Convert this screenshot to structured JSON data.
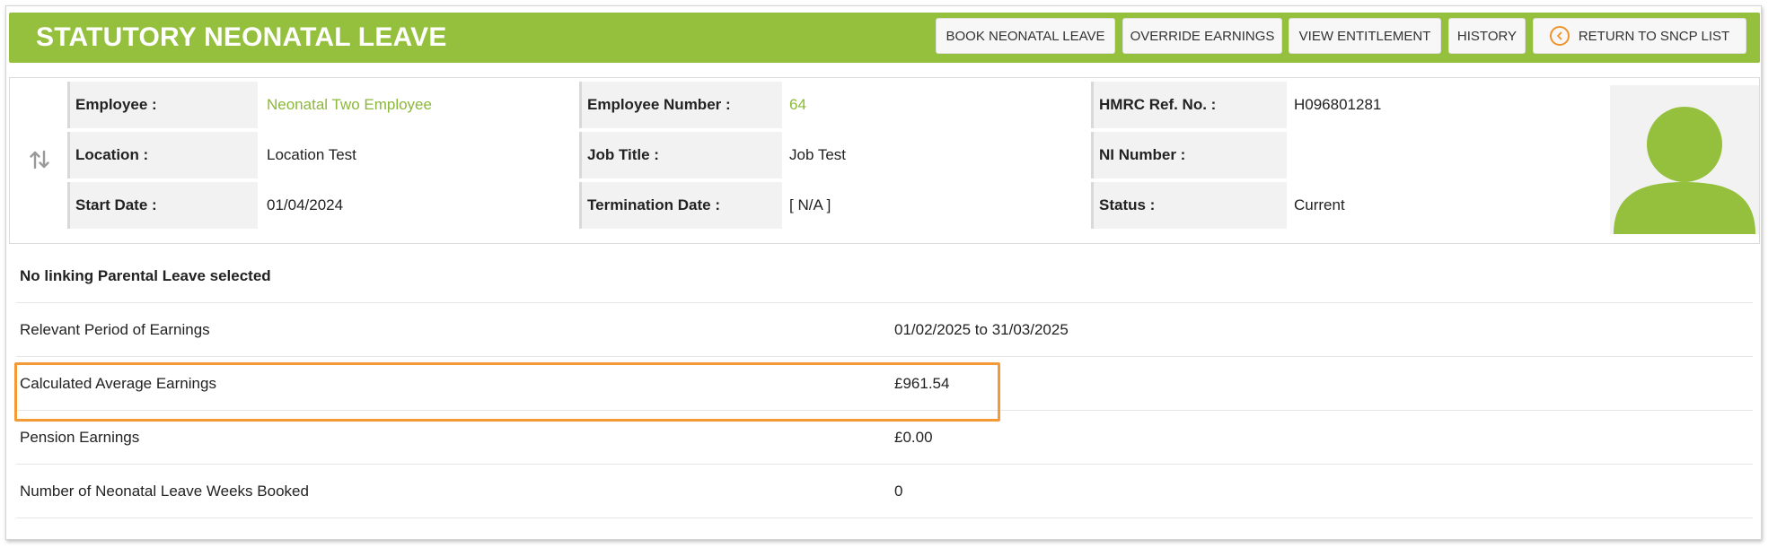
{
  "header": {
    "title": "STATUTORY NEONATAL LEAVE",
    "buttons": {
      "book": "BOOK NEONATAL LEAVE",
      "override": "OVERRIDE EARNINGS",
      "entitlement": "VIEW ENTITLEMENT",
      "history": "HISTORY",
      "return": "RETURN TO SNCP LIST"
    },
    "return_icon": "chevron-left-circle-icon"
  },
  "employee": {
    "employee_label": "Employee :",
    "employee_value": "Neonatal Two Employee",
    "number_label": "Employee Number :",
    "number_value": "64",
    "hmrc_label": "HMRC Ref. No. :",
    "hmrc_value": "H096801281",
    "location_label": "Location :",
    "location_value": "Location Test",
    "job_label": "Job Title :",
    "job_value": "Job Test",
    "ni_label": "NI Number :",
    "ni_value": "",
    "start_label": "Start Date :",
    "start_value": "01/04/2024",
    "termination_label": "Termination Date :",
    "termination_value": "[ N/A ]",
    "status_label": "Status :",
    "status_value": "Current",
    "swap_icon": "swap-vertical-icon",
    "avatar_icon": "user-avatar-icon"
  },
  "details": {
    "heading": "No linking Parental Leave selected",
    "rows": [
      {
        "label": "Relevant Period of Earnings",
        "value": "01/02/2025 to 31/03/2025"
      },
      {
        "label": "Calculated Average Earnings",
        "value": "£961.54"
      },
      {
        "label": "Pension Earnings",
        "value": "£0.00"
      },
      {
        "label": "Number of Neonatal Leave Weeks Booked",
        "value": "0"
      }
    ]
  },
  "colors": {
    "brand_green": "#95c03d",
    "link_green": "#8cb83a",
    "highlight_orange": "#f39a36"
  }
}
